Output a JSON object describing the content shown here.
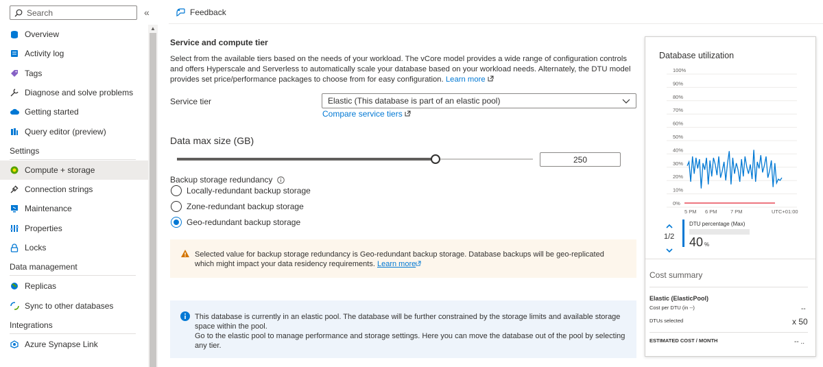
{
  "sidebar": {
    "search_placeholder": "Search",
    "collapse_glyph": "«",
    "items_top": [
      {
        "label": "Overview",
        "icon": "database-icon",
        "color": "#0078d4"
      },
      {
        "label": "Activity log",
        "icon": "activity-log-icon",
        "color": "#0078d4"
      },
      {
        "label": "Tags",
        "icon": "tag-icon",
        "color": "#8661c5"
      },
      {
        "label": "Diagnose and solve problems",
        "icon": "wrench-icon",
        "color": "#323130"
      },
      {
        "label": "Getting started",
        "icon": "cloud-icon",
        "color": "#0078d4"
      },
      {
        "label": "Query editor (preview)",
        "icon": "query-editor-icon",
        "color": "#0078d4"
      }
    ],
    "settings_title": "Settings",
    "settings_items": [
      {
        "label": "Compute + storage",
        "icon": "compute-icon",
        "color": "#57a300",
        "selected": true
      },
      {
        "label": "Connection strings",
        "icon": "connection-icon",
        "color": "#323130"
      },
      {
        "label": "Maintenance",
        "icon": "maintenance-icon",
        "color": "#0078d4"
      },
      {
        "label": "Properties",
        "icon": "properties-icon",
        "color": "#0078d4"
      },
      {
        "label": "Locks",
        "icon": "lock-icon",
        "color": "#0078d4"
      }
    ],
    "data_title": "Data management",
    "data_items": [
      {
        "label": "Replicas",
        "icon": "globe-icon",
        "color": "#0078d4"
      },
      {
        "label": "Sync to other databases",
        "icon": "sync-icon",
        "color": "#0078d4"
      }
    ],
    "integrations_title": "Integrations",
    "integrations_items": [
      {
        "label": "Azure Synapse Link",
        "icon": "synapse-icon",
        "color": "#0078d4"
      }
    ]
  },
  "topbar": {
    "feedback": "Feedback"
  },
  "main": {
    "title": "Service and compute tier",
    "description": "Select from the available tiers based on the needs of your workload. The vCore model provides a wide range of configuration controls and offers Hyperscale and Serverless to automatically scale your database based on your workload needs. Alternately, the DTU model provides set price/performance packages to choose from for easy configuration.",
    "learn_more": "Learn more",
    "service_tier_label": "Service tier",
    "service_tier_value": "Elastic (This database is part of an elastic pool)",
    "compare_link": "Compare service tiers",
    "data_max_title": "Data max size (GB)",
    "data_max_value": "250",
    "slider_fraction": 0.726,
    "backup_label": "Backup storage redundancy",
    "backup_options": [
      {
        "label": "Locally-redundant backup storage",
        "checked": false
      },
      {
        "label": "Zone-redundant backup storage",
        "checked": false
      },
      {
        "label": "Geo-redundant backup storage",
        "checked": true
      }
    ],
    "warning_text": "Selected value for backup storage redundancy is Geo-redundant backup storage. Database backups will be geo-replicated which might impact your data residency requirements.",
    "warning_link": "Learn more",
    "info_line1": "This database is currently in an elastic pool. The database will be further constrained by the storage limits and available storage space within the pool.",
    "info_line2": "Go to the elastic pool to manage performance and storage settings. Here you can move the database out of the pool by selecting any tier."
  },
  "panel": {
    "title": "Database utilization",
    "legend_page": "1/2",
    "legend_name": "DTU percentage (Max)",
    "legend_value": "40",
    "legend_unit": "%",
    "cost_title": "Cost summary",
    "elastic_label": "Elastic (ElasticPool)",
    "cost_per_dtu": "Cost per DTU (in --)",
    "cost_per_dtu_value": "--",
    "dtus_label": "DTUs selected",
    "dtus_value": "x 50",
    "estimated_label": "ESTIMATED COST / MONTH",
    "estimated_value": "-- .."
  },
  "chart_data": {
    "type": "line",
    "ylabels": [
      "100%",
      "90%",
      "80%",
      "70%",
      "60%",
      "50%",
      "40%",
      "30%",
      "20%",
      "10%",
      "0%"
    ],
    "xlabels": [
      "5 PM",
      "6 PM",
      "7 PM",
      "UTC+01:00"
    ],
    "ylim": [
      0,
      100
    ],
    "series": [
      {
        "name": "DTU percentage (Max)",
        "color": "#0078d4",
        "values": [
          28,
          31,
          16,
          35,
          22,
          34,
          26,
          33,
          11,
          30,
          25,
          34,
          14,
          32,
          20,
          34,
          29,
          21,
          35,
          19,
          24,
          31,
          17,
          30,
          39,
          14,
          34,
          22,
          30,
          25,
          16,
          33,
          20,
          35,
          27,
          22,
          29,
          18,
          40,
          16,
          31,
          26,
          36,
          23,
          28,
          35,
          19,
          24,
          32,
          12,
          30,
          15,
          18,
          17,
          19
        ]
      },
      {
        "name": "",
        "color": "#e74856",
        "values": [
          0,
          0
        ]
      }
    ]
  }
}
